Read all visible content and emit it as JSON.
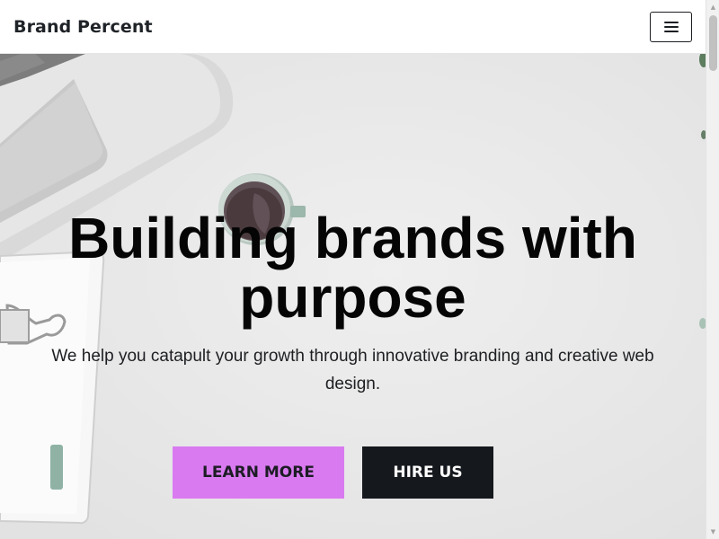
{
  "header": {
    "brand": "Brand Percent",
    "menu_icon": "hamburger-menu-icon"
  },
  "hero": {
    "headline": "Building brands with purpose",
    "subtext": "We help you catapult your growth through innovative branding and creative web design.",
    "background_image": "desk-with-laptop-coffee-cup-and-notebook",
    "learn_more_label": "LEARN MORE",
    "hire_us_label": "HIRE US"
  },
  "colors": {
    "learn_more_bg": "#d97af0",
    "hire_us_bg": "#15181d",
    "hero_bg": "#e9e9e9"
  },
  "scrollbar": {
    "up_icon": "scroll-up-arrow-icon",
    "down_icon": "scroll-down-arrow-icon"
  }
}
